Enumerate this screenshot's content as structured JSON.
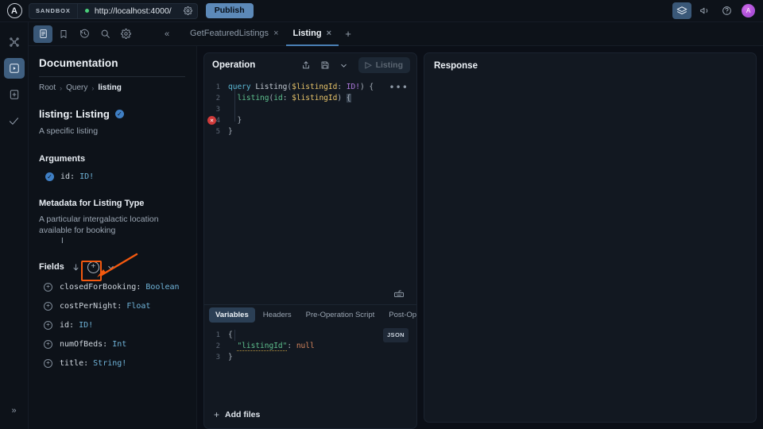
{
  "topbar": {
    "logo_letter": "A",
    "env_label": "SANDBOX",
    "url": "http://localhost:4000/",
    "publish_label": "Publish",
    "icons": {
      "url_gear": "gear-icon",
      "status_dot": "connected-dot",
      "layers": "layers-icon",
      "megaphone": "megaphone-icon",
      "help": "help-circle-icon",
      "avatar_letter": "A"
    }
  },
  "rail": {
    "items": [
      {
        "name": "graph-icon",
        "label": "Graph"
      },
      {
        "name": "explorer-icon",
        "label": "Explorer",
        "active": true
      },
      {
        "name": "schema-icon",
        "label": "Schema"
      },
      {
        "name": "checks-icon",
        "label": "Checks"
      }
    ],
    "expand_label": "»"
  },
  "toolbar": {
    "icons": [
      {
        "name": "documentation-icon",
        "active": true
      },
      {
        "name": "bookmark-icon",
        "active": false
      },
      {
        "name": "history-icon",
        "active": false
      },
      {
        "name": "search-icon",
        "active": false
      },
      {
        "name": "settings-gear-icon",
        "active": false
      }
    ],
    "collapse_label": "«"
  },
  "tabs": {
    "items": [
      {
        "label": "GetFeaturedListings",
        "close": "×",
        "active": false
      },
      {
        "label": "Listing",
        "close": "×",
        "active": true
      }
    ],
    "add_label": "+"
  },
  "docs": {
    "heading": "Documentation",
    "breadcrumb": {
      "root": "Root",
      "sep": "›",
      "query": "Query",
      "current": "listing"
    },
    "field_signature": "listing: Listing",
    "field_description": "A specific listing",
    "arguments_heading": "Arguments",
    "arguments": [
      {
        "name": "id:",
        "type": "ID!"
      }
    ],
    "metadata_heading": "Metadata for Listing Type",
    "metadata_description": "A particular intergalactic location available for booking",
    "fields_heading": "Fields",
    "fields_sort_icon": "arrow-down-icon",
    "fields_add_icon": "plus-circle-icon",
    "fields_collapse_icon": "chevron-down-icon",
    "fields": [
      {
        "name": "closedForBooking:",
        "type": "Boolean"
      },
      {
        "name": "costPerNight:",
        "type": "Float"
      },
      {
        "name": "id:",
        "type": "ID!"
      },
      {
        "name": "numOfBeds:",
        "type": "Int"
      },
      {
        "name": "title:",
        "type": "String!"
      }
    ]
  },
  "operation": {
    "title": "Operation",
    "share_icon": "share-icon",
    "save_icon": "save-icon",
    "chevron_icon": "chevron-down-icon",
    "run_button": {
      "label": "Listing",
      "play": "▷",
      "disabled": true
    },
    "more_menu": "•••",
    "error_marker": "×",
    "keyboard_icon": "keyboard-icon",
    "code_lines": [
      {
        "n": "1",
        "tokens": [
          {
            "t": "query ",
            "c": "k-query"
          },
          {
            "t": "Listing",
            "c": "k-name"
          },
          {
            "t": "(",
            "c": "k-punc"
          },
          {
            "t": "$listingId",
            "c": "k-var"
          },
          {
            "t": ": ",
            "c": "k-punc"
          },
          {
            "t": "ID!",
            "c": "k-type"
          },
          {
            "t": ") {",
            "c": "k-punc"
          }
        ]
      },
      {
        "n": "2",
        "tokens": [
          {
            "t": "  ",
            "c": "k-punc"
          },
          {
            "t": "listing",
            "c": "k-field"
          },
          {
            "t": "(",
            "c": "k-punc"
          },
          {
            "t": "id",
            "c": "k-field"
          },
          {
            "t": ": ",
            "c": "k-punc"
          },
          {
            "t": "$listingId",
            "c": "k-var"
          },
          {
            "t": ") ",
            "c": "k-punc"
          },
          {
            "t": "{",
            "c": "k-punc cursor-brace"
          }
        ]
      },
      {
        "n": "3",
        "tokens": []
      },
      {
        "n": "4",
        "tokens": [
          {
            "t": "  ",
            "c": "k-punc"
          },
          {
            "t": "}",
            "c": "k-punc"
          }
        ]
      },
      {
        "n": "5",
        "tokens": [
          {
            "t": "}",
            "c": "k-punc"
          }
        ]
      }
    ]
  },
  "variables": {
    "tabs": [
      {
        "label": "Variables",
        "active": true
      },
      {
        "label": "Headers",
        "active": false
      },
      {
        "label": "Pre-Operation Script",
        "active": false
      },
      {
        "label": "Post-Op",
        "active": false
      }
    ],
    "format_badge": "JSON",
    "code_lines": [
      {
        "n": "1",
        "tokens": [
          {
            "t": "{",
            "c": "k-punc"
          }
        ]
      },
      {
        "n": "2",
        "tokens": [
          {
            "t": "  ",
            "c": "k-punc"
          },
          {
            "t": "\"listingId\"",
            "c": "j-key"
          },
          {
            "t": ": ",
            "c": "k-punc"
          },
          {
            "t": "null",
            "c": "j-null"
          }
        ]
      },
      {
        "n": "3",
        "tokens": [
          {
            "t": "}",
            "c": "k-punc"
          }
        ]
      }
    ],
    "add_files_label": "Add files",
    "add_files_plus": "+"
  },
  "response": {
    "title": "Response"
  },
  "annotation": {
    "color": "#f4590f",
    "target": "fields-add-plus-icon"
  },
  "colors": {
    "bg": "#0b0f17",
    "panel": "#121821",
    "accent_blue": "#4a7fb5",
    "publish": "#5c89b8",
    "annotation_orange": "#f4590f",
    "error_red": "#cf3a3a",
    "status_green": "#4ad07a"
  }
}
